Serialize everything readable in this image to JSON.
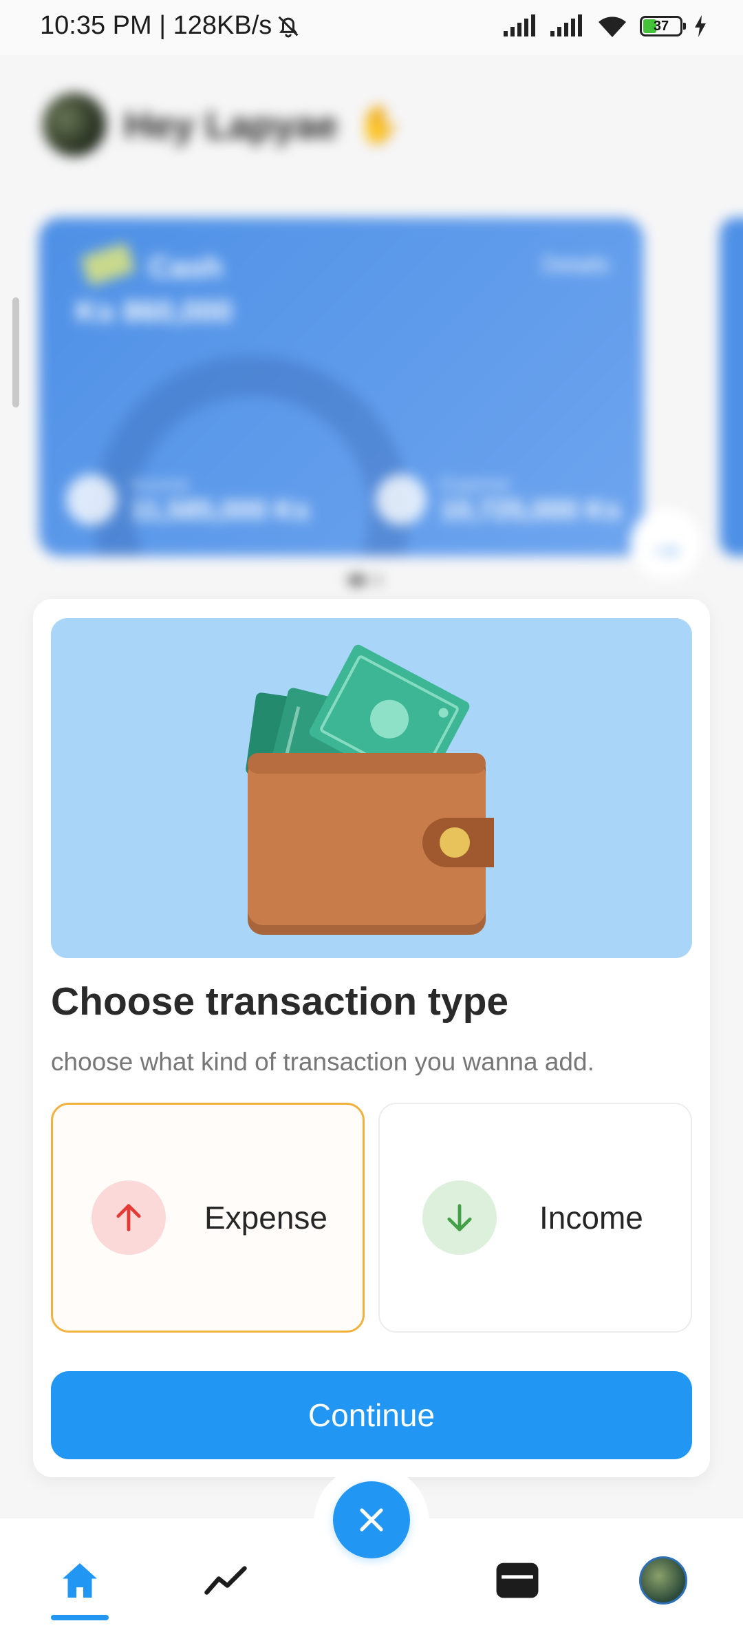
{
  "status_bar": {
    "time_speed": "10:35 PM | 128KB/s",
    "battery": "37"
  },
  "background": {
    "greeting": "Hey Lapyae",
    "card_name": "Cash",
    "card_details": "Details",
    "card_balance": "Ks 860,000",
    "income_label": "Income",
    "income_value": "11,585,000 Ks",
    "expense_label": "Expense",
    "expense_value": "10,725,000 Ks"
  },
  "sheet": {
    "title": "Choose transaction type",
    "subtitle": "choose what kind of transaction you wanna add.",
    "options": [
      {
        "label": "Expense",
        "selected": true,
        "icon": "arrow-up-icon",
        "color": "#e53935"
      },
      {
        "label": "Income",
        "selected": false,
        "icon": "arrow-down-icon",
        "color": "#43a047"
      }
    ],
    "continue_label": "Continue"
  },
  "nav": {
    "items": [
      "home-icon",
      "stats-icon",
      "wallet-icon",
      "profile-avatar"
    ],
    "active": "home-icon",
    "fab_icon": "close-icon"
  },
  "colors": {
    "accent": "#2196f3",
    "selected_border": "#f2b13e",
    "illustration_bg": "#a9d5f8"
  }
}
